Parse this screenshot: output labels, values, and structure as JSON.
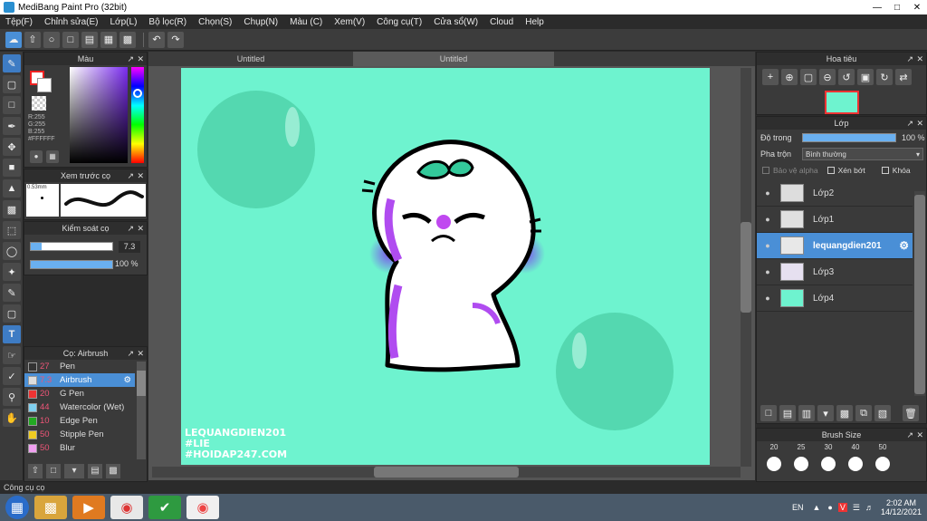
{
  "window": {
    "title": "MediBang Paint Pro (32bit)"
  },
  "menu": [
    "Tệp(F)",
    "Chỉnh sửa(E)",
    "Lớp(L)",
    "Bộ lọc(R)",
    "Chọn(S)",
    "Chụp(N)",
    "Màu (C)",
    "Xem(V)",
    "Công cụ(T)",
    "Cửa sổ(W)",
    "Cloud",
    "Help"
  ],
  "tabs": [
    "Untitled",
    "Untitled"
  ],
  "color_panel": {
    "title": "Màu",
    "r": "R:255",
    "g": "G:255",
    "b": "B:255",
    "hex": "#FFFFFF"
  },
  "preview_panel": {
    "title": "Xem trước cọ",
    "size": "0.53mm"
  },
  "control_panel": {
    "title": "Kiểm soát cọ",
    "size_value": "7.3",
    "opacity_value": "100 %"
  },
  "brush_panel": {
    "title": "Cọ: Airbrush",
    "items": [
      {
        "size": "27",
        "name": "Pen",
        "color": "#333333"
      },
      {
        "size": "7.3",
        "name": "Airbrush",
        "color": "#dddddd"
      },
      {
        "size": "20",
        "name": "G Pen",
        "color": "#ee3333"
      },
      {
        "size": "44",
        "name": "Watercolor (Wet)",
        "color": "#7fd0f0"
      },
      {
        "size": "10",
        "name": "Edge Pen",
        "color": "#22aa22"
      },
      {
        "size": "50",
        "name": "Stipple Pen",
        "color": "#eecc22"
      },
      {
        "size": "50",
        "name": "Blur",
        "color": "#f0a0f0"
      }
    ]
  },
  "navigator": {
    "title": "Hoa tiêu"
  },
  "layer_panel": {
    "title": "Lớp",
    "opacity_label": "Độ trong",
    "opacity_value": "100 %",
    "blend_label": "Pha trộn",
    "blend_value": "Bình thường",
    "protect_alpha": "Bảo vệ alpha",
    "clipping": "Xén bớt",
    "lock": "Khóa",
    "layers": [
      "Lớp2",
      "Lớp1",
      "lequangdien201",
      "Lớp3",
      "Lớp4"
    ]
  },
  "brush_size_panel": {
    "title": "Brush Size",
    "sizes": [
      "20",
      "25",
      "30",
      "40",
      "50"
    ]
  },
  "canvas_text": [
    "LEQUANGDIEN201",
    "#LIE",
    "#HOIDAP247.COM"
  ],
  "status": "Công cụ cọ",
  "tray": {
    "lang": "EN",
    "time": "2:02 AM",
    "date": "14/12/2021"
  }
}
